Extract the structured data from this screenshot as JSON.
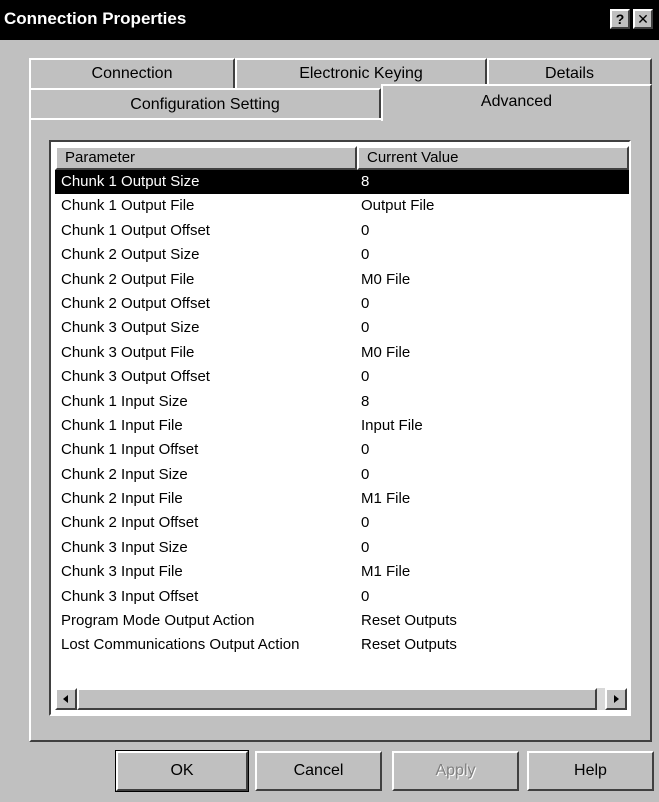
{
  "window": {
    "title": "Connection Properties"
  },
  "titlebar_buttons": {
    "help": "?",
    "close": "✕"
  },
  "tabs": {
    "back_row": [
      "Connection",
      "Electronic Keying",
      "Details"
    ],
    "front_row": [
      "Configuration Setting",
      "Advanced"
    ],
    "active": "Advanced"
  },
  "list": {
    "columns": [
      "Parameter",
      "Current Value"
    ],
    "rows": [
      {
        "param": "Chunk 1 Output Size",
        "value": "8"
      },
      {
        "param": "Chunk 1 Output File",
        "value": "Output File"
      },
      {
        "param": "Chunk 1 Output Offset",
        "value": "0"
      },
      {
        "param": "Chunk 2 Output Size",
        "value": "0"
      },
      {
        "param": "Chunk 2 Output File",
        "value": "M0 File"
      },
      {
        "param": "Chunk 2 Output Offset",
        "value": "0"
      },
      {
        "param": "Chunk 3 Output Size",
        "value": "0"
      },
      {
        "param": "Chunk 3 Output File",
        "value": "M0 File"
      },
      {
        "param": "Chunk 3 Output Offset",
        "value": "0"
      },
      {
        "param": "Chunk 1 Input Size",
        "value": "8"
      },
      {
        "param": "Chunk 1 Input File",
        "value": "Input File"
      },
      {
        "param": "Chunk 1 Input Offset",
        "value": "0"
      },
      {
        "param": "Chunk 2 Input Size",
        "value": "0"
      },
      {
        "param": "Chunk 2 Input File",
        "value": "M1 File"
      },
      {
        "param": "Chunk 2 Input Offset",
        "value": "0"
      },
      {
        "param": "Chunk 3 Input Size",
        "value": "0"
      },
      {
        "param": "Chunk 3 Input File",
        "value": "M1 File"
      },
      {
        "param": "Chunk 3 Input Offset",
        "value": "0"
      },
      {
        "param": "Program Mode Output Action",
        "value": "Reset Outputs"
      },
      {
        "param": "Lost Communications Output Action",
        "value": "Reset Outputs"
      }
    ],
    "selected_index": 0
  },
  "scrollbar": {
    "left_arrow": "◄",
    "right_arrow": "►"
  },
  "buttons": {
    "ok": "OK",
    "cancel": "Cancel",
    "apply": "Apply",
    "help": "Help"
  }
}
